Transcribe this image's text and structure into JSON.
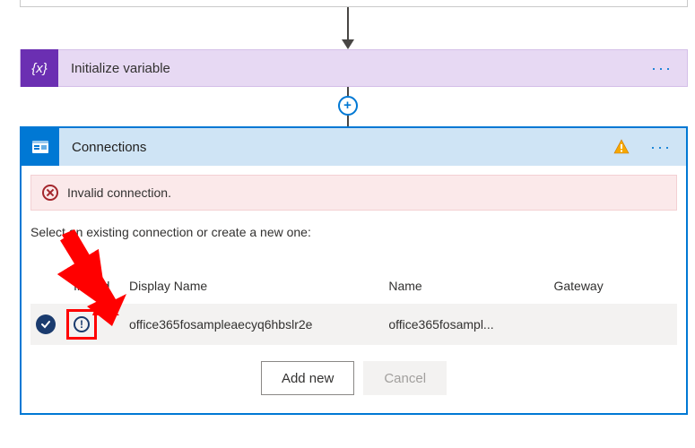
{
  "init_card": {
    "title": "Initialize variable"
  },
  "connections_card": {
    "title": "Connections",
    "error_message": "Invalid connection.",
    "instruction": "Select an existing connection or create a new one:",
    "columns": {
      "invalid": "Invalid",
      "display_name": "Display Name",
      "name": "Name",
      "gateway": "Gateway"
    },
    "rows": [
      {
        "selected": true,
        "invalid": true,
        "display_name": "office365fosampleaecyq6hbslr2e",
        "name": "office365fosampl...",
        "gateway": ""
      }
    ],
    "buttons": {
      "add_new": "Add new",
      "cancel": "Cancel"
    }
  },
  "icons": {
    "variable": "{x}",
    "plus": "+",
    "more": "···",
    "invalid_mark": "!"
  }
}
